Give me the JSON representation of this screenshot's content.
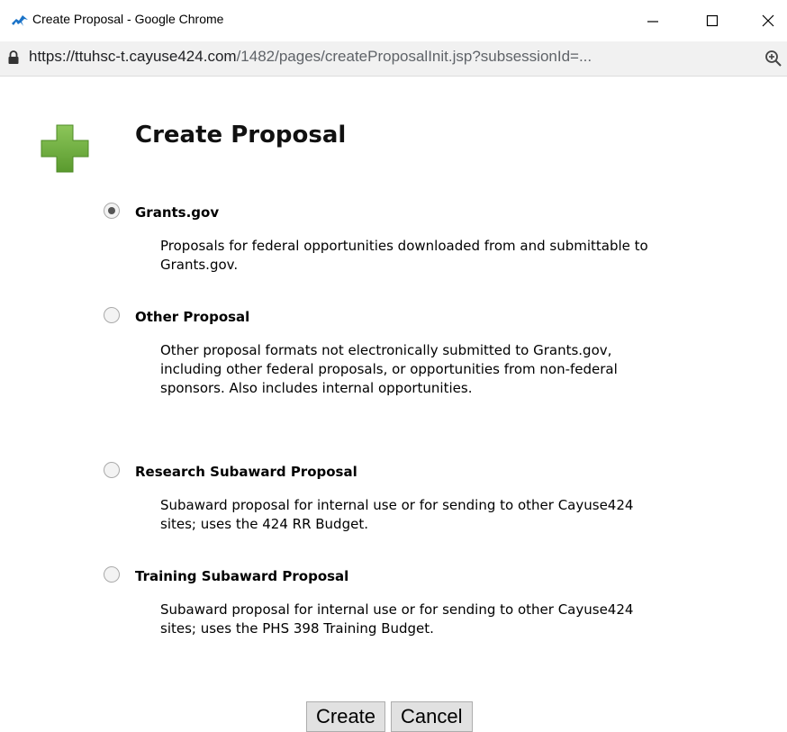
{
  "window": {
    "title": "Create Proposal - Google Chrome",
    "minimize_label": "—",
    "maximize_label": "☐",
    "close_label": "✕"
  },
  "address": {
    "url_host": "https://ttuhsc-t.cayuse424.com",
    "url_path": "/1482/pages/createProposalInit.jsp?subsessionId=..."
  },
  "page": {
    "title": "Create Proposal"
  },
  "options": [
    {
      "label": "Grants.gov",
      "description": "Proposals for federal opportunities downloaded from and submittable to Grants.gov.",
      "selected": true
    },
    {
      "label": "Other Proposal",
      "description": "Other proposal formats not electronically submitted to Grants.gov, including other federal proposals, or opportunities from non-federal sponsors. Also includes internal opportunities.",
      "selected": false
    },
    {
      "label": "Research Subaward Proposal",
      "description": "Subaward proposal for internal use or for sending to other Cayuse424 sites; uses the 424 RR Budget.",
      "selected": false
    },
    {
      "label": "Training Subaward Proposal",
      "description": "Subaward proposal for internal use or for sending to other Cayuse424 sites; uses the PHS 398 Training Budget.",
      "selected": false
    }
  ],
  "actions": {
    "create_label": "Create",
    "cancel_label": "Cancel"
  },
  "colors": {
    "plus_icon": "#6aab3a",
    "app_icon": "#1a73c8"
  }
}
